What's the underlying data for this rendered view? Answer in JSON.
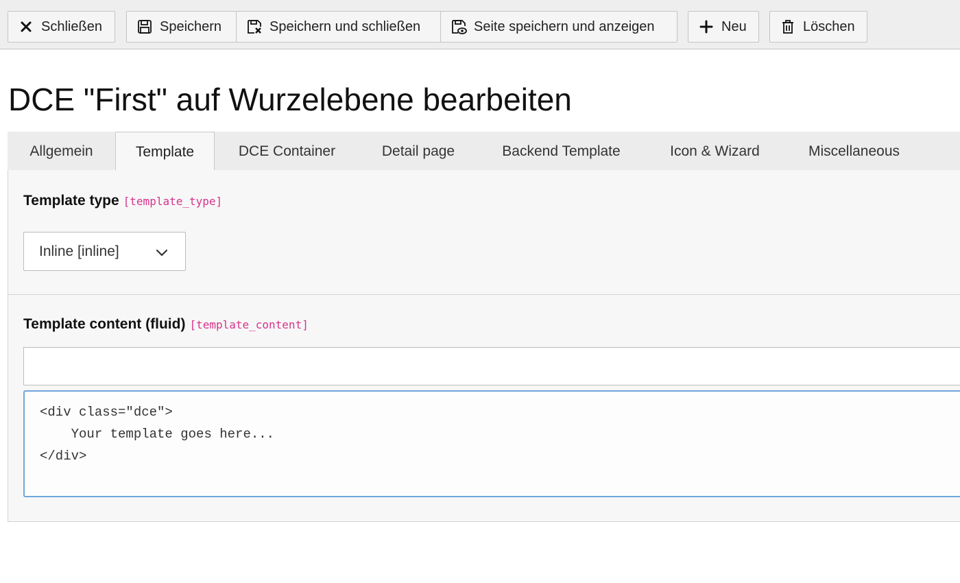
{
  "toolbar": {
    "close_label": "Schließen",
    "save_label": "Speichern",
    "save_close_label": "Speichern und schließen",
    "save_view_label": "Seite speichern und anzeigen",
    "new_label": "Neu",
    "delete_label": "Löschen",
    "icons": {
      "close": "close-icon",
      "save": "save-icon",
      "save_close": "save-close-icon",
      "save_view": "save-view-icon",
      "new": "plus-icon",
      "delete": "trash-icon"
    }
  },
  "page": {
    "title": "DCE \"First\" auf Wurzelebene bearbeiten"
  },
  "tabs": [
    {
      "label": "Allgemein",
      "active": false
    },
    {
      "label": "Template",
      "active": true
    },
    {
      "label": "DCE Container",
      "active": false
    },
    {
      "label": "Detail page",
      "active": false
    },
    {
      "label": "Backend Template",
      "active": false
    },
    {
      "label": "Icon & Wizard",
      "active": false
    },
    {
      "label": "Miscellaneous",
      "active": false
    }
  ],
  "fields": {
    "template_type": {
      "label": "Template type",
      "key": "[template_type]",
      "selected": "Inline [inline]"
    },
    "template_content": {
      "label": "Template content (fluid)",
      "key": "[template_content]",
      "input_value": "",
      "code": "<div class=\"dce\">\n    Your template goes here...\n</div>"
    }
  },
  "colors": {
    "field_key": "#d6338b",
    "focus_border": "#6ea6dc",
    "toolbar_bg": "#eeeeee"
  }
}
